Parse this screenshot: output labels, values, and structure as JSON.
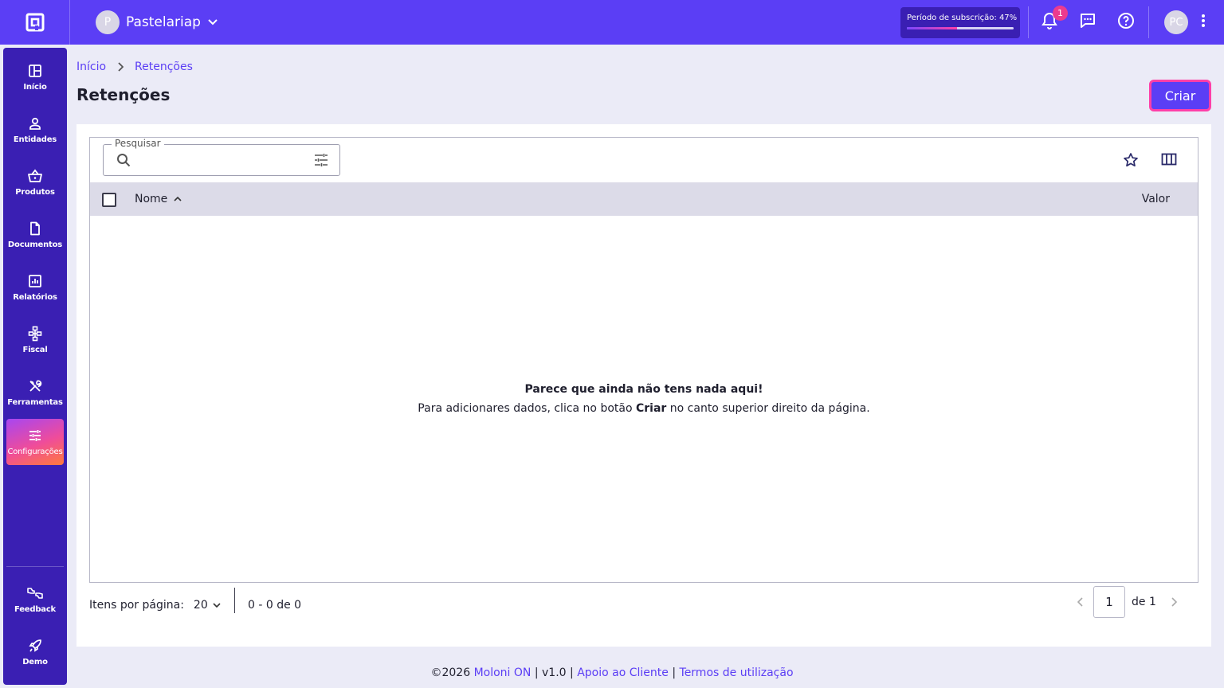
{
  "topbar": {
    "company_initial": "P",
    "company_name": "Pastelariap",
    "subscription_label": "Período de subscrição: 47%",
    "subscription_progress": 0.47,
    "notifications_count": "1",
    "user_initials": "PC"
  },
  "sidebar": {
    "items": [
      {
        "label": "Início",
        "icon": "dashboard-icon"
      },
      {
        "label": "Entidades",
        "icon": "person-icon"
      },
      {
        "label": "Produtos",
        "icon": "basket-icon"
      },
      {
        "label": "Documentos",
        "icon": "document-icon"
      },
      {
        "label": "Relatórios",
        "icon": "report-chart-icon"
      },
      {
        "label": "Fiscal",
        "icon": "fiscal-hierarchy-icon"
      },
      {
        "label": "Ferramentas",
        "icon": "tools-icon"
      },
      {
        "label": "Configurações",
        "icon": "settings-sliders-icon",
        "active": true
      }
    ],
    "bottom": [
      {
        "label": "Feedback",
        "icon": "feedback-icon"
      },
      {
        "label": "Demo",
        "icon": "rocket-icon"
      }
    ]
  },
  "breadcrumb": {
    "home": "Início",
    "current": "Retenções"
  },
  "page": {
    "title": "Retenções",
    "create_label": "Criar"
  },
  "search": {
    "legend": "Pesquisar",
    "placeholder": ""
  },
  "table": {
    "columns": [
      "Nome",
      "Valor"
    ],
    "empty_title": "Parece que ainda não tens nada aqui!",
    "empty_text_before": "Para adicionares dados, clica no botão ",
    "empty_text_bold": "Criar",
    "empty_text_after": " no canto superior direito da página."
  },
  "pagination": {
    "items_per_page_label": "Itens por página:",
    "page_size": "20",
    "range": "0 - 0 de 0",
    "current_page": "1",
    "of_pages": "de 1"
  },
  "footer": {
    "copyright": "©2026",
    "brand": "Moloni ON",
    "version": "v1.0",
    "support": "Apoio ao Cliente",
    "terms": "Termos de utilização"
  },
  "colors": {
    "primary": "#5b3ef5",
    "sidebar": "#3a1fb3",
    "accent_pink": "#ff3fa8",
    "background": "#ebebf7"
  }
}
